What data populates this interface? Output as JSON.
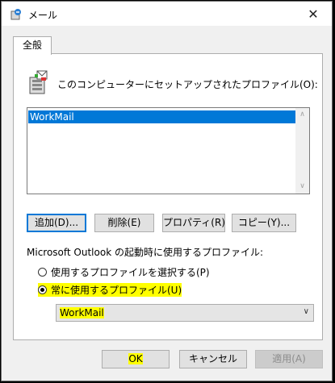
{
  "window": {
    "title": "メール",
    "close_glyph": "✕"
  },
  "tab": {
    "label": "全般"
  },
  "profiles": {
    "intro_label": "このコンピューターにセットアップされたプロファイル(O):",
    "items": [
      "WorkMail"
    ]
  },
  "actions": {
    "add": "追加(D)...",
    "delete": "削除(E)",
    "properties": "プロパティ(R)",
    "copy": "コピー(Y)..."
  },
  "startup": {
    "label": "Microsoft Outlook の起動時に使用するプロファイル:",
    "option_prompt": "使用するプロファイルを選択する(P)",
    "option_always": "常に使用するプロファイル(U)",
    "selected_profile": "WorkMail"
  },
  "footer": {
    "ok": "OK",
    "cancel": "キャンセル",
    "apply": "適用(A)"
  },
  "colors": {
    "selection": "#0078d7",
    "highlight": "#ffff00"
  }
}
